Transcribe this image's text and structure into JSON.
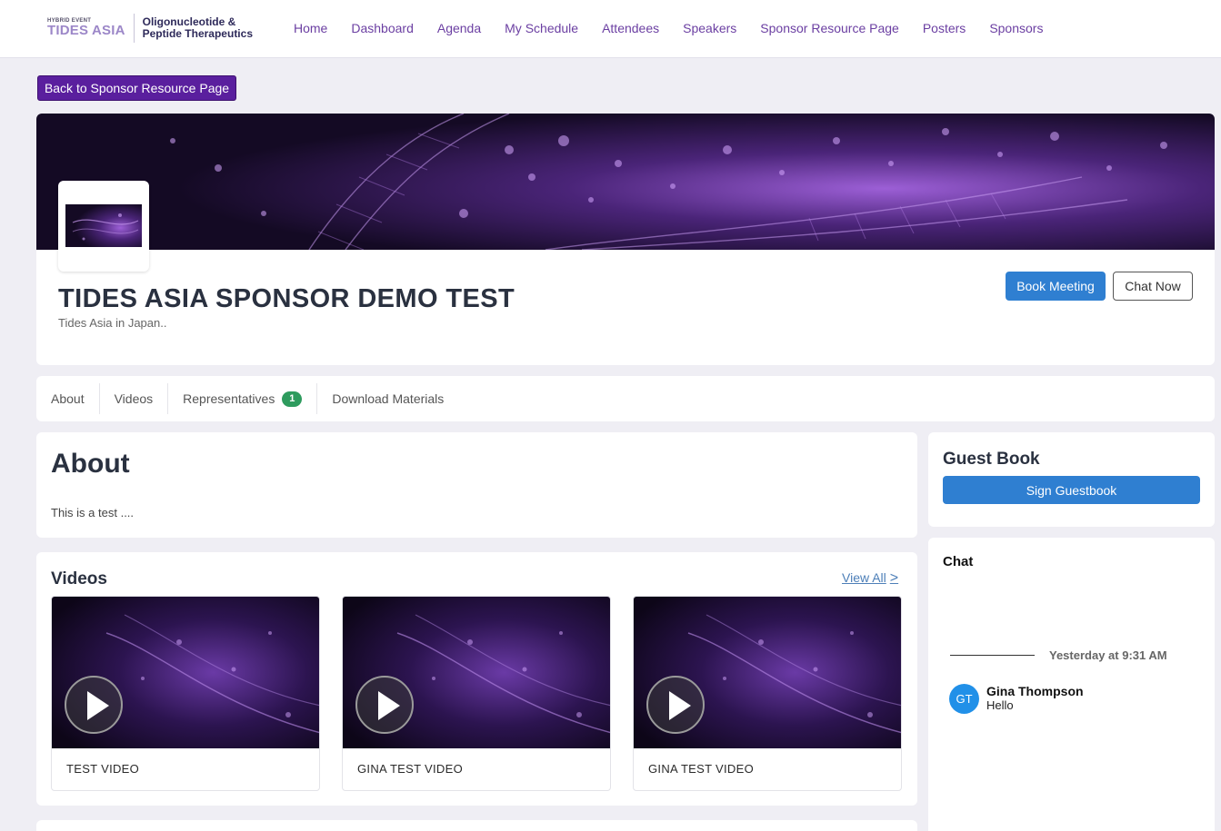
{
  "logo": {
    "small": "HYBRID EVENT",
    "brand": "TIDES ASIA",
    "line1": "Oligonucleotide &",
    "line2": "Peptide Therapeutics"
  },
  "nav": [
    "Home",
    "Dashboard",
    "Agenda",
    "My Schedule",
    "Attendees",
    "Speakers",
    "Sponsor Resource Page",
    "Posters",
    "Sponsors"
  ],
  "back_button": "Back to Sponsor Resource Page",
  "sponsor": {
    "title": "TIDES ASIA SPONSOR DEMO TEST",
    "subtitle": "Tides Asia in Japan..",
    "book_meeting": "Book Meeting",
    "chat_now": "Chat Now"
  },
  "tabs": {
    "about": "About",
    "videos": "Videos",
    "representatives": "Representatives",
    "representatives_count": "1",
    "download": "Download Materials"
  },
  "about": {
    "title": "About",
    "text": "This is a test ...."
  },
  "videos": {
    "title": "Videos",
    "view_all": "View All",
    "view_all_icon": ">",
    "items": [
      "TEST VIDEO",
      "GINA TEST VIDEO",
      "GINA TEST VIDEO"
    ]
  },
  "guestbook": {
    "title": "Guest Book",
    "button": "Sign Guestbook"
  },
  "chat": {
    "title": "Chat",
    "timestamp": "Yesterday at 9:31 AM",
    "message": {
      "initials": "GT",
      "name": "Gina Thompson",
      "text": "Hello"
    }
  },
  "colors": {
    "accent_purple": "#5a1f9e",
    "nav_purple": "#6b3fa2",
    "primary_blue": "#2f7fd1",
    "badge_green": "#2e9b5e",
    "avatar_blue": "#2190e8"
  }
}
